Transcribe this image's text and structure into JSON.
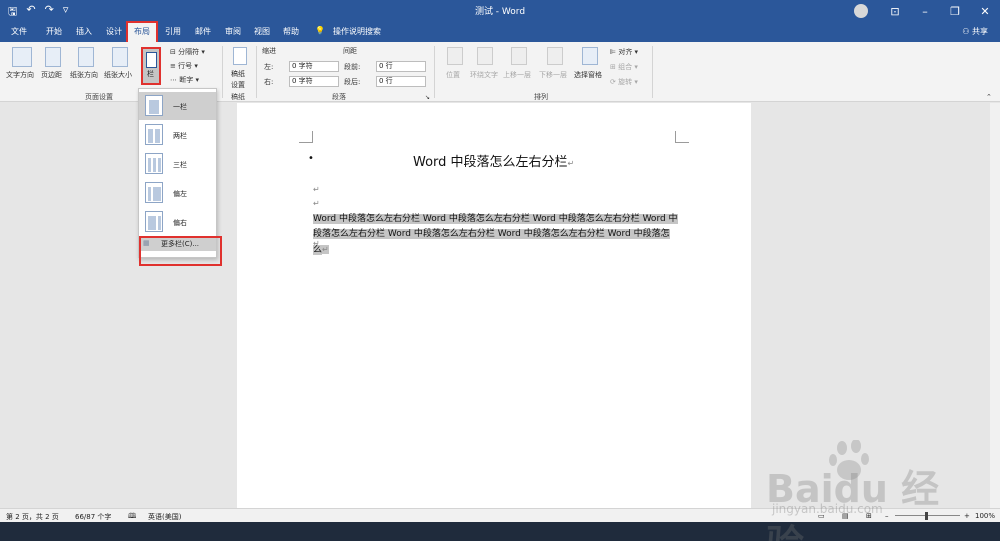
{
  "window": {
    "title": "测试 - Word"
  },
  "tabs": [
    "文件",
    "开始",
    "插入",
    "设计",
    "布局",
    "引用",
    "邮件",
    "审阅",
    "视图",
    "帮助"
  ],
  "active_tab": "布局",
  "tell_me": "操作说明搜索",
  "share": "共享",
  "ribbon": {
    "page_setup": {
      "text_direction": "文字方向",
      "margins": "页边距",
      "orientation": "纸张方向",
      "size": "纸张大小",
      "columns": "栏",
      "breaks": "分隔符",
      "line_numbers": "行号",
      "hyphenation": "断字",
      "group_label": "页面设置"
    },
    "draft_paper": {
      "button": "稿纸\n设置",
      "button_l1": "稿纸",
      "button_l2": "设置",
      "group_label": "稿纸"
    },
    "paragraph": {
      "indent_label": "缩进",
      "spacing_label": "间距",
      "left_label": "左:",
      "left_value": "0 字符",
      "right_label": "右:",
      "right_value": "0 字符",
      "before_label": "段前:",
      "before_value": "0 行",
      "after_label": "段后:",
      "after_value": "0 行",
      "group_label": "段落"
    },
    "arrange": {
      "position": "位置",
      "wrap_text": "环绕文字",
      "bring_forward": "上移一层",
      "send_backward": "下移一层",
      "selection_pane": "选择窗格",
      "align": "对齐",
      "group": "组合",
      "rotate": "旋转",
      "group_label": "排列"
    }
  },
  "columns_menu": {
    "items": [
      "一栏",
      "两栏",
      "三栏",
      "偏左",
      "偏右"
    ],
    "more": "更多栏(C)..."
  },
  "document": {
    "heading": "Word 中段落怎么左右分栏",
    "paragraph_line1": "Word 中段落怎么左右分栏 Word 中段落怎么左右分栏 Word 中段落怎么左右分栏 Word 中",
    "paragraph_line2": "段落怎么左右分栏 Word 中段落怎么左右分栏 Word 中段落怎么左右分栏 Word 中段落怎么"
  },
  "statusbar": {
    "page": "第 2 页，共 2 页",
    "words": "66/87 个字",
    "language": "英语(美国)",
    "zoom": "100%"
  },
  "watermark": {
    "brand": "Baidu 经验",
    "url": "jingyan.baidu.com"
  }
}
